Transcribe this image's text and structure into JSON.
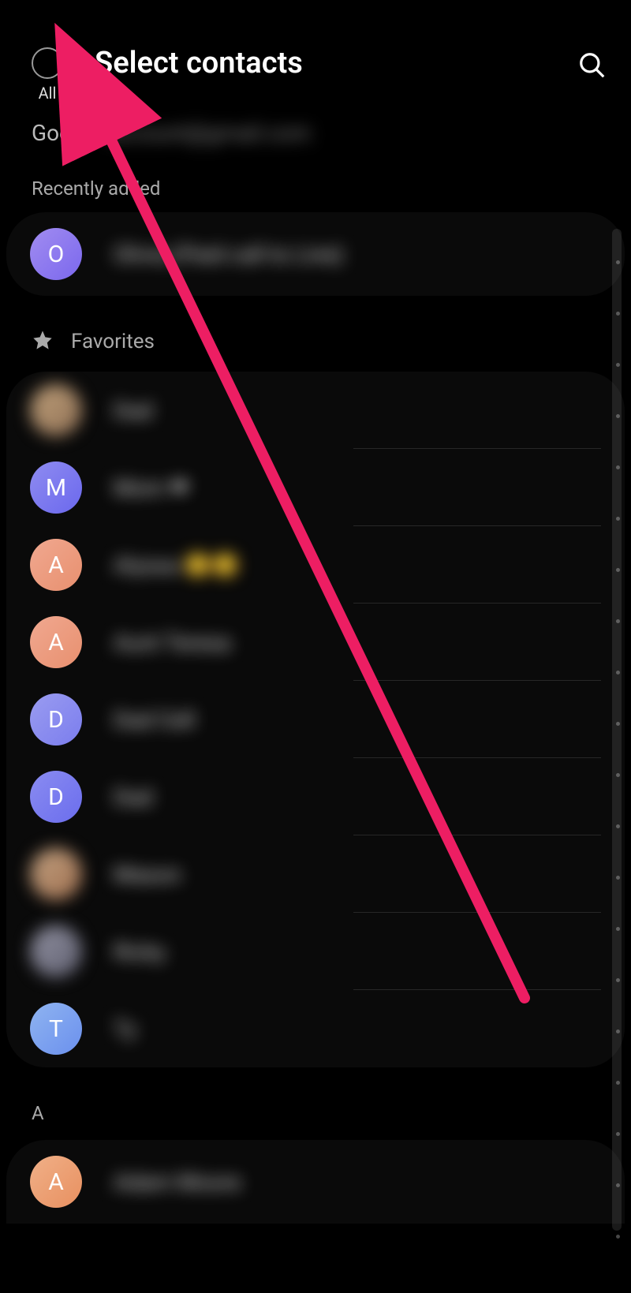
{
  "header": {
    "select_all_label": "All",
    "title": "Select contacts"
  },
  "account": {
    "provider": "Google",
    "email_blurred": "account@gmail.com"
  },
  "sections": {
    "recent_label": "Recently added",
    "favorites_label": "Favorites"
  },
  "recent": [
    {
      "initial": "O",
      "name_blurred": "Olivia (Paid call to Line)",
      "avatar_color": "linear-gradient(135deg,#a18cf0,#7b68ee)"
    }
  ],
  "favorites": [
    {
      "initial": "",
      "name_blurred": "Dad",
      "avatar_color": "linear-gradient(135deg,#bfa07a,#8f7055)",
      "avatar_blur": true
    },
    {
      "initial": "M",
      "name_blurred": "Mom ❤",
      "avatar_color": "linear-gradient(135deg,#8f8cf0,#6b68ee)"
    },
    {
      "initial": "A",
      "name_blurred": "Alyssa 😊😊",
      "avatar_color": "linear-gradient(135deg,#f0a890,#e8906f)"
    },
    {
      "initial": "A",
      "name_blurred": "Aunt Teresa",
      "avatar_color": "linear-gradient(135deg,#f0a890,#e8906f)"
    },
    {
      "initial": "D",
      "name_blurred": "Dad Cell",
      "avatar_color": "linear-gradient(135deg,#9a9cf0,#7b7dee)"
    },
    {
      "initial": "D",
      "name_blurred": "Dad",
      "avatar_color": "linear-gradient(135deg,#8a8cf0,#6b6dee)"
    },
    {
      "initial": "",
      "name_blurred": "Mason",
      "avatar_color": "linear-gradient(135deg,#c0a080,#a07050)",
      "avatar_blur": true
    },
    {
      "initial": "",
      "name_blurred": "Ricky",
      "avatar_color": "linear-gradient(135deg,#9090a0,#606070)",
      "avatar_blur": true
    },
    {
      "initial": "T",
      "name_blurred": "Ty",
      "avatar_color": "linear-gradient(135deg,#8fb4f0,#6b90ee)"
    }
  ],
  "alpha": {
    "letter": "A",
    "contacts": [
      {
        "initial": "A",
        "name_blurred": "Adam Moore",
        "avatar_color": "linear-gradient(135deg,#f0b088,#e89060)"
      }
    ]
  },
  "annotation": {
    "arrow_color": "#e91e63"
  }
}
